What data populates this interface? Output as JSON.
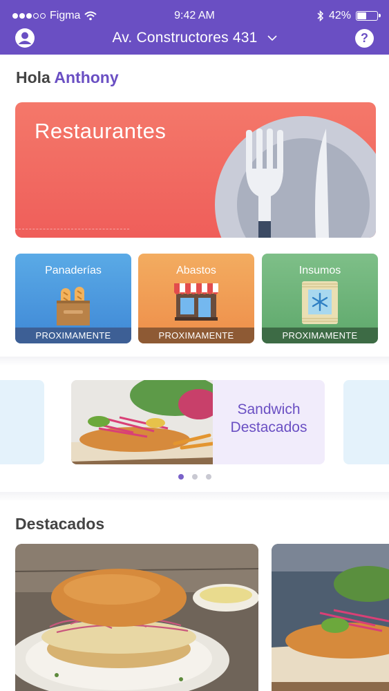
{
  "status_bar": {
    "carrier": "Figma",
    "time": "9:42 AM",
    "battery": "42%",
    "battery_level": 0.42
  },
  "header": {
    "address": "Av. Constructores 431"
  },
  "greeting": {
    "prefix": "Hola",
    "name": "Anthony"
  },
  "banner": {
    "title": "Restaurantes"
  },
  "categories": [
    {
      "label": "Panaderías",
      "badge": "PROXIMAMENTE"
    },
    {
      "label": "Abastos",
      "badge": "PROXIMAMENTE"
    },
    {
      "label": "Insumos",
      "badge": "PROXIMAMENTE"
    }
  ],
  "carousel": {
    "title_line1": "Sandwich",
    "title_line2": "Destacados",
    "page_count": 3,
    "active_page": 1
  },
  "featured": {
    "title": "Destacados"
  },
  "colors": {
    "brand": "#6a4fc3",
    "banner": "#ef5e5a",
    "panaderias": "#4a95dd",
    "abastos": "#f09a52",
    "insumos": "#6cb178"
  }
}
